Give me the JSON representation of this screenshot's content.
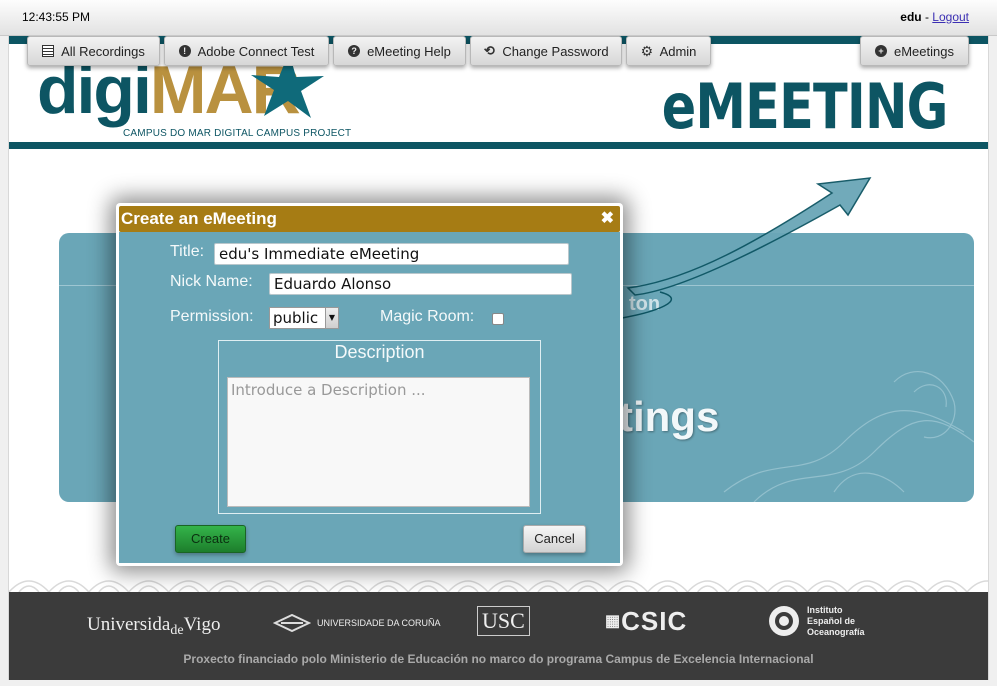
{
  "topbar": {
    "time": "12:43:55 PM",
    "user": "edu",
    "separator": " - ",
    "logout": "Logout"
  },
  "header": {
    "logo_digi": "digi",
    "logo_mar": "MAR",
    "logo_tagline": "CAMPUS DO MAR DIGITAL CAMPUS PROJECT",
    "brand": "eMEETING"
  },
  "nav": [
    {
      "label": "All Recordings",
      "icon": "list-icon"
    },
    {
      "label": "Adobe Connect Test",
      "icon": "exclamation-icon"
    },
    {
      "label": "eMeeting Help",
      "icon": "question-icon"
    },
    {
      "label": "Change Password",
      "icon": "repeat-icon"
    },
    {
      "label": "Admin",
      "icon": "gear-icon"
    },
    {
      "label": "eMeetings",
      "icon": "plus-circle-icon"
    }
  ],
  "background": {
    "partial_button": "ton",
    "partial_heading": "tings"
  },
  "dialog": {
    "title": "Create an eMeeting",
    "close": "✖",
    "title_label": "Title:",
    "title_value": "edu's Immediate eMeeting",
    "nick_label": "Nick Name:",
    "nick_value": "Eduardo Alonso",
    "permission_label": "Permission:",
    "permission_value": "public",
    "magic_label": "Magic Room:",
    "magic_checked": false,
    "description_legend": "Description",
    "description_placeholder": "Introduce a Description ...",
    "create": "Create",
    "cancel": "Cancel"
  },
  "footer": {
    "logos": [
      "Universida",
      "de",
      "Vigo",
      "UNIVERSIDADE DA CORUÑA",
      "USC",
      "CSIC",
      "Instituto",
      "Español de",
      "Oceanografía"
    ],
    "note": "Proxecto financiado polo Ministerio de Educación no marco do programa Campus de Excelencia Internacional"
  },
  "colors": {
    "teal": "#0d5563",
    "gold": "#b9913f",
    "panel": "#6aa6b7",
    "dialog_title": "#a67c14",
    "footer": "#3b3b3b"
  }
}
